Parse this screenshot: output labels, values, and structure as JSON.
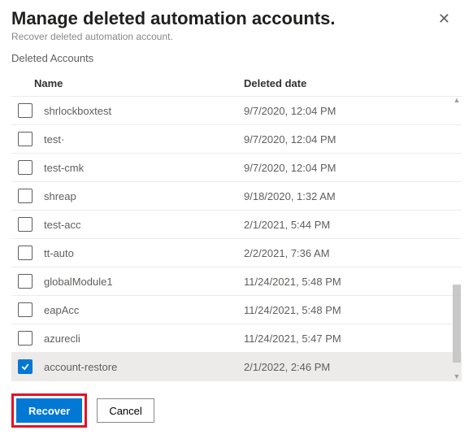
{
  "header": {
    "title": "Manage deleted automation accounts.",
    "subtitle": "Recover deleted automation account."
  },
  "section_label": "Deleted Accounts",
  "columns": {
    "name": "Name",
    "date": "Deleted date"
  },
  "rows": [
    {
      "name": "shrlockboxtest",
      "date": "9/7/2020, 12:04 PM",
      "checked": false
    },
    {
      "name": "test·",
      "date": "9/7/2020, 12:04 PM",
      "checked": false
    },
    {
      "name": "test-cmk",
      "date": "9/7/2020, 12:04 PM",
      "checked": false
    },
    {
      "name": "shreap",
      "date": "9/18/2020, 1:32 AM",
      "checked": false
    },
    {
      "name": "test-acc",
      "date": "2/1/2021, 5:44 PM",
      "checked": false
    },
    {
      "name": "tt-auto",
      "date": "2/2/2021, 7:36 AM",
      "checked": false
    },
    {
      "name": "globalModule1",
      "date": "11/24/2021, 5:48 PM",
      "checked": false
    },
    {
      "name": "eapAcc",
      "date": "11/24/2021, 5:48 PM",
      "checked": false
    },
    {
      "name": "azurecli",
      "date": "11/24/2021, 5:47 PM",
      "checked": false
    },
    {
      "name": "account-restore",
      "date": "2/1/2022, 2:46 PM",
      "checked": true
    }
  ],
  "footer": {
    "recover": "Recover",
    "cancel": "Cancel"
  }
}
